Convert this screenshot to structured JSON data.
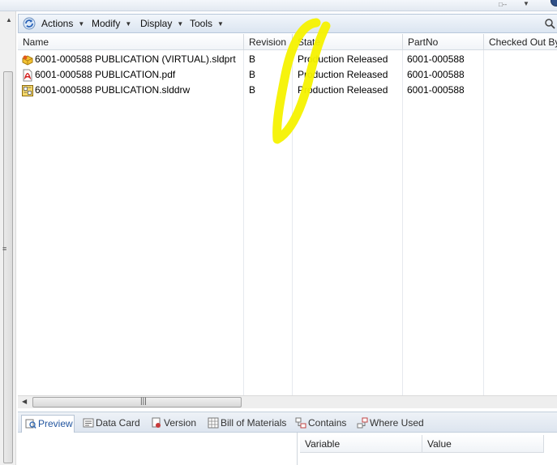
{
  "toolbar": {
    "menus": [
      {
        "label": "Actions"
      },
      {
        "label": "Modify"
      },
      {
        "label": "Display"
      },
      {
        "label": "Tools"
      }
    ]
  },
  "table": {
    "columns": [
      "Name",
      "Revision",
      "State",
      "PartNo",
      "Checked Out By"
    ],
    "rows": [
      {
        "icon": "sldprt-part-icon",
        "name": "6001-000588 PUBLICATION (VIRTUAL).sldprt",
        "revision": "B",
        "state": "Production Released",
        "partno": "6001-000588"
      },
      {
        "icon": "pdf-file-icon",
        "name": "6001-000588 PUBLICATION.pdf",
        "revision": "B",
        "state": "Production Released",
        "partno": "6001-000588"
      },
      {
        "icon": "slddrw-drawing-icon",
        "name": "6001-000588 PUBLICATION.slddrw",
        "revision": "B",
        "state": "Production Released",
        "partno": "6001-000588"
      }
    ]
  },
  "tabs": [
    {
      "label": "Preview",
      "icon": "preview-icon",
      "active": true
    },
    {
      "label": "Data Card",
      "icon": "data-card-icon",
      "active": false
    },
    {
      "label": "Version",
      "icon": "version-icon",
      "active": false
    },
    {
      "label": "Bill of Materials",
      "icon": "bill-of-materials-icon",
      "active": false
    },
    {
      "label": "Contains",
      "icon": "contains-icon",
      "active": false
    },
    {
      "label": "Where Used",
      "icon": "where-used-icon",
      "active": false
    }
  ],
  "variables": {
    "columns": [
      "Variable",
      "Value"
    ]
  },
  "colors": {
    "accent": "#22559f",
    "highlighter": "#f5f200"
  }
}
